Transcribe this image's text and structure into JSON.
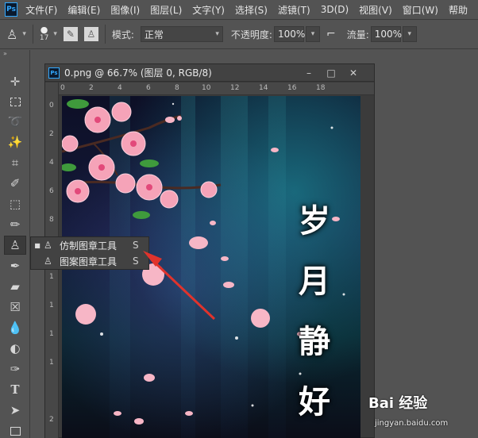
{
  "menubar": {
    "logo": "Ps",
    "items": [
      "文件(F)",
      "编辑(E)",
      "图像(I)",
      "图层(L)",
      "文字(Y)",
      "选择(S)",
      "滤镜(T)",
      "3D(D)",
      "视图(V)",
      "窗口(W)",
      "帮助"
    ]
  },
  "options": {
    "brush_size": "17",
    "mode_label": "模式:",
    "mode_value": "正常",
    "opacity_label": "不透明度:",
    "opacity_value": "100%",
    "flow_label": "流量:",
    "flow_value": "100%"
  },
  "document": {
    "title": "0.png @ 66.7% (图层 0, RGB/8)",
    "icon": "Ps",
    "ruler_top": [
      "0",
      "2",
      "4",
      "6",
      "8",
      "10",
      "12",
      "14",
      "16",
      "18"
    ],
    "ruler_left": [
      "0",
      "2",
      "4",
      "6",
      "8",
      "1",
      "1",
      "1",
      "1",
      "2"
    ],
    "poem": [
      "岁",
      "月",
      "静",
      "好"
    ]
  },
  "flyout": {
    "items": [
      {
        "label": "仿制图章工具",
        "shortcut": "S",
        "selected": true
      },
      {
        "label": "图案图章工具",
        "shortcut": "S",
        "selected": false
      }
    ]
  },
  "watermark": {
    "main": "Bai 经验",
    "sub": "jingyan.baidu.com"
  },
  "colors": {
    "ui_bg": "#535353",
    "panel_dark": "#424242",
    "accent_ps": "#31a8ff",
    "arrow_red": "#e0332c"
  }
}
